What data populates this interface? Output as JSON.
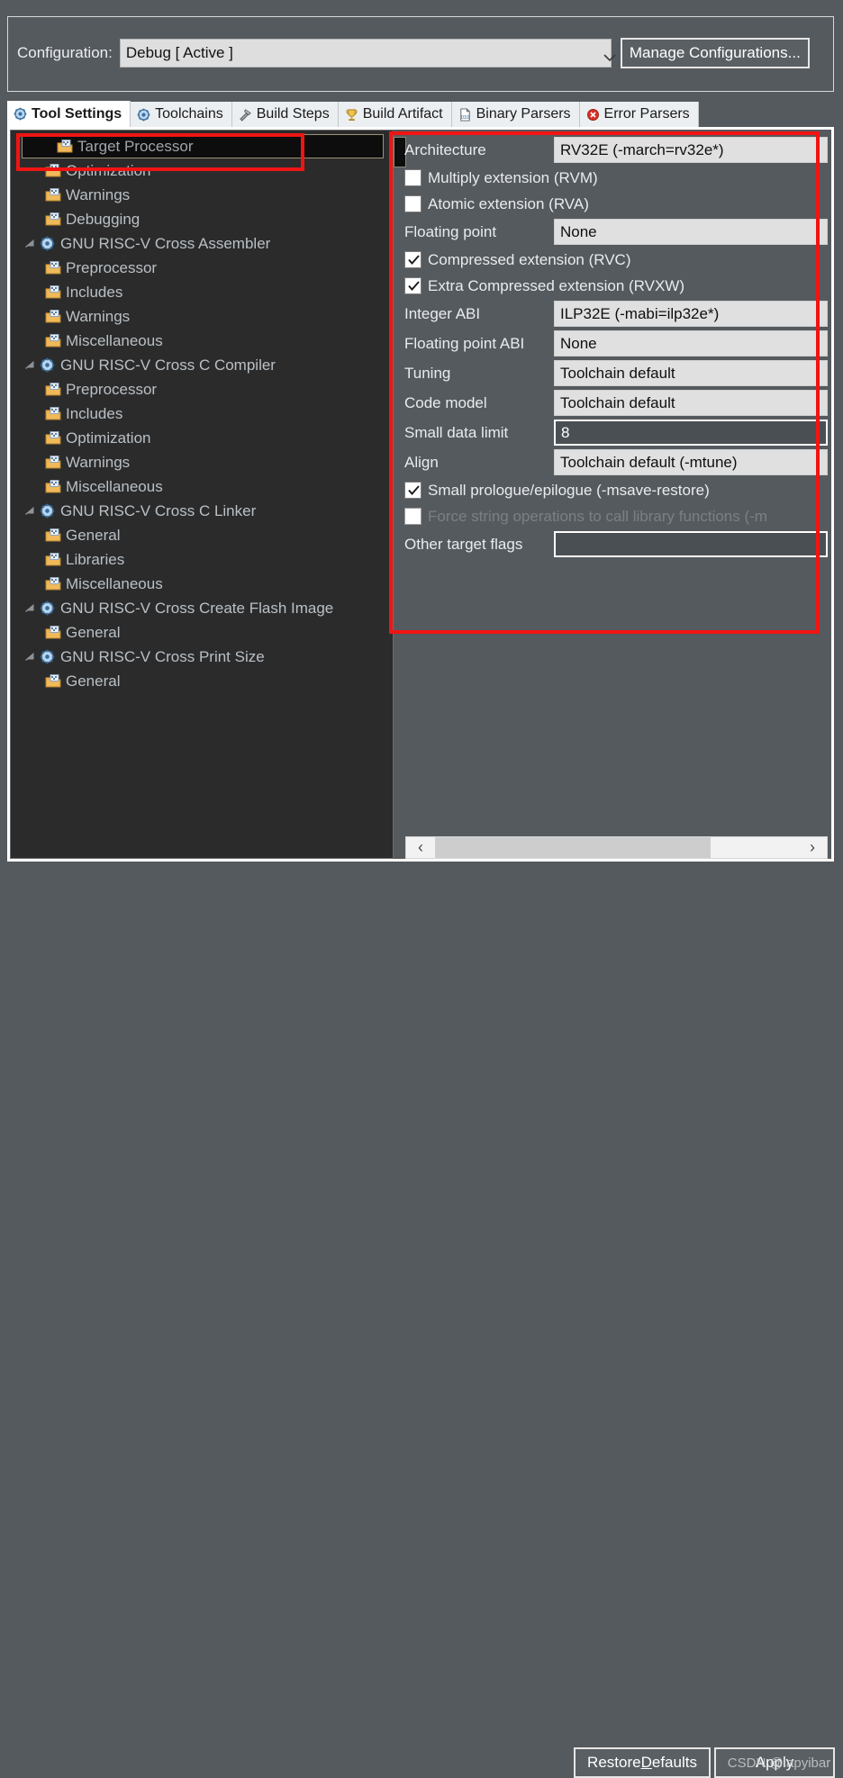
{
  "config": {
    "label": "Configuration:",
    "value": "Debug  [ Active ]",
    "caret_icon": "chevron-down-icon",
    "manage_button": "Manage Configurations..."
  },
  "tabs": [
    {
      "label": "Tool Settings",
      "icon": "gear-blue-icon",
      "active": true
    },
    {
      "label": "Toolchains",
      "icon": "gear-blue-icon",
      "active": false
    },
    {
      "label": "Build Steps",
      "icon": "hammer-icon",
      "active": false
    },
    {
      "label": "Build Artifact",
      "icon": "trophy-icon",
      "active": false
    },
    {
      "label": "Binary Parsers",
      "icon": "binary-file-icon",
      "active": false
    },
    {
      "label": "Error Parsers",
      "icon": "error-circle-icon",
      "active": false
    }
  ],
  "tree": [
    {
      "label": "Target Processor",
      "indent": 1,
      "icon": "folder-icon",
      "twisty": "none",
      "selected": true
    },
    {
      "label": "Optimization",
      "indent": 1,
      "icon": "folder-icon",
      "twisty": "none",
      "selected": false
    },
    {
      "label": "Warnings",
      "indent": 1,
      "icon": "folder-icon",
      "twisty": "none",
      "selected": false
    },
    {
      "label": "Debugging",
      "indent": 1,
      "icon": "folder-icon",
      "twisty": "none",
      "selected": false
    },
    {
      "label": "GNU RISC-V Cross Assembler",
      "indent": 0,
      "icon": "gear-blue-icon",
      "twisty": "expanded",
      "selected": false
    },
    {
      "label": "Preprocessor",
      "indent": 1,
      "icon": "folder-icon",
      "twisty": "none",
      "selected": false
    },
    {
      "label": "Includes",
      "indent": 1,
      "icon": "folder-icon",
      "twisty": "none",
      "selected": false
    },
    {
      "label": "Warnings",
      "indent": 1,
      "icon": "folder-icon",
      "twisty": "none",
      "selected": false
    },
    {
      "label": "Miscellaneous",
      "indent": 1,
      "icon": "folder-icon",
      "twisty": "none",
      "selected": false
    },
    {
      "label": "GNU RISC-V Cross C Compiler",
      "indent": 0,
      "icon": "gear-blue-icon",
      "twisty": "expanded",
      "selected": false
    },
    {
      "label": "Preprocessor",
      "indent": 1,
      "icon": "folder-icon",
      "twisty": "none",
      "selected": false
    },
    {
      "label": "Includes",
      "indent": 1,
      "icon": "folder-icon",
      "twisty": "none",
      "selected": false
    },
    {
      "label": "Optimization",
      "indent": 1,
      "icon": "folder-icon",
      "twisty": "none",
      "selected": false
    },
    {
      "label": "Warnings",
      "indent": 1,
      "icon": "folder-icon",
      "twisty": "none",
      "selected": false
    },
    {
      "label": "Miscellaneous",
      "indent": 1,
      "icon": "folder-icon",
      "twisty": "none",
      "selected": false
    },
    {
      "label": "GNU RISC-V Cross C Linker",
      "indent": 0,
      "icon": "gear-blue-icon",
      "twisty": "expanded",
      "selected": false
    },
    {
      "label": "General",
      "indent": 1,
      "icon": "folder-icon",
      "twisty": "none",
      "selected": false
    },
    {
      "label": "Libraries",
      "indent": 1,
      "icon": "folder-icon",
      "twisty": "none",
      "selected": false
    },
    {
      "label": "Miscellaneous",
      "indent": 1,
      "icon": "folder-icon",
      "twisty": "none",
      "selected": false
    },
    {
      "label": "GNU RISC-V Cross Create Flash Image",
      "indent": 0,
      "icon": "gear-blue-icon",
      "twisty": "expanded",
      "selected": false
    },
    {
      "label": "General",
      "indent": 1,
      "icon": "folder-icon",
      "twisty": "none",
      "selected": false
    },
    {
      "label": "GNU RISC-V Cross Print Size",
      "indent": 0,
      "icon": "gear-blue-icon",
      "twisty": "expanded",
      "selected": false
    },
    {
      "label": "General",
      "indent": 1,
      "icon": "folder-icon",
      "twisty": "none",
      "selected": false
    }
  ],
  "settings": [
    {
      "kind": "field",
      "label": "Architecture",
      "value": "RV32E (-march=rv32e*)",
      "style": "readonly"
    },
    {
      "kind": "checkbox",
      "label": "Multiply extension (RVM)",
      "checked": false,
      "disabled": false
    },
    {
      "kind": "checkbox",
      "label": "Atomic extension (RVA)",
      "checked": false,
      "disabled": false
    },
    {
      "kind": "field",
      "label": "Floating point",
      "value": "None",
      "style": "readonly"
    },
    {
      "kind": "checkbox",
      "label": "Compressed extension (RVC)",
      "checked": true,
      "disabled": false
    },
    {
      "kind": "checkbox",
      "label": "Extra Compressed extension (RVXW)",
      "checked": true,
      "disabled": false
    },
    {
      "kind": "field",
      "label": "Integer ABI",
      "value": "ILP32E (-mabi=ilp32e*)",
      "style": "readonly"
    },
    {
      "kind": "field",
      "label": "Floating point ABI",
      "value": "None",
      "style": "readonly"
    },
    {
      "kind": "field",
      "label": "Tuning",
      "value": "Toolchain default",
      "style": "readonly"
    },
    {
      "kind": "field",
      "label": "Code model",
      "value": "Toolchain default",
      "style": "readonly"
    },
    {
      "kind": "field",
      "label": "Small data limit",
      "value": "8",
      "style": "editable"
    },
    {
      "kind": "field",
      "label": "Align",
      "value": "Toolchain default (-mtune)",
      "style": "readonly"
    },
    {
      "kind": "checkbox",
      "label": "Small prologue/epilogue (-msave-restore)",
      "checked": true,
      "disabled": false
    },
    {
      "kind": "checkbox",
      "label": "Force string operations to call library functions (-m",
      "checked": false,
      "disabled": true
    },
    {
      "kind": "field",
      "label": "Other target flags",
      "value": "",
      "style": "empty"
    }
  ],
  "hscroll": {
    "left_arrow": "‹",
    "right_arrow": "›"
  },
  "buttons": {
    "restore_prefix": "Restore ",
    "restore_mnemonic": "D",
    "restore_suffix": "efaults",
    "apply": "Apply"
  },
  "watermark": "CSDN @lapyibar",
  "colors": {
    "window_bg": "#555a5e",
    "tree_bg": "#2b2b2b",
    "field_bg": "#e0e0e0",
    "annotation_red": "#f01414",
    "tab_active_bg": "#ffffff"
  }
}
